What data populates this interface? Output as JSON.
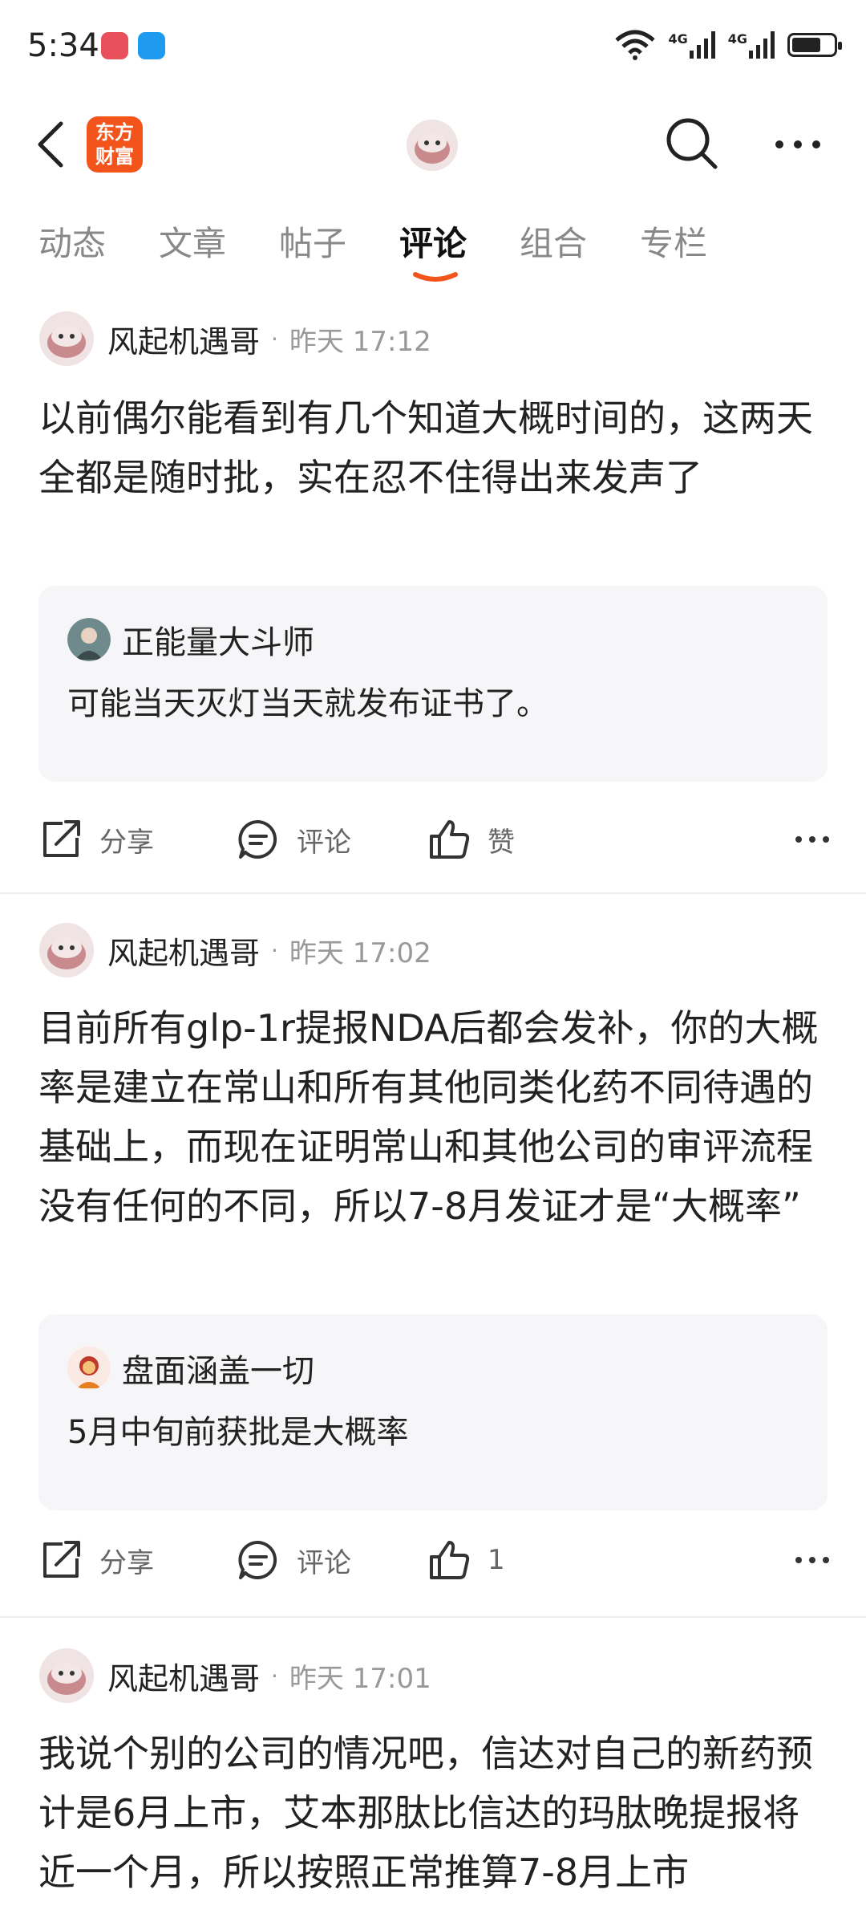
{
  "status_bar": {
    "time": "5:34",
    "network_1": "4G",
    "network_2": "4G",
    "battery_level": 0.7
  },
  "header": {
    "logo_line1": "东方",
    "logo_line2": "财富"
  },
  "tabs": [
    "动态",
    "文章",
    "帖子",
    "评论",
    "组合",
    "专栏"
  ],
  "active_tab": "评论",
  "posts": [
    {
      "author": "风起机遇哥",
      "time": "昨天 17:12",
      "text": "以前偶尔能看到有几个知道大概时间的，这两天全都是随时批，实在忍不住得出来发声了",
      "quote": {
        "user": "正能量大斗师",
        "text": "可能当天灭灯当天就发布证书了。"
      },
      "share_label": "分享",
      "comment_label": "评论",
      "like_label": "赞"
    },
    {
      "author": "风起机遇哥",
      "time": "昨天 17:02",
      "text": "目前所有glp-1r提报NDA后都会发补，你的大概率是建立在常山和所有其他同类化药不同待遇的基础上，而现在证明常山和其他公司的审评流程没有任何的不同，所以7-8月发证才是“大概率”",
      "quote": {
        "user": "盘面涵盖一切",
        "text": "5月中旬前获批是大概率"
      },
      "share_label": "分享",
      "comment_label": "评论",
      "like_label": "1"
    },
    {
      "author": "风起机遇哥",
      "time": "昨天 17:01",
      "text": "我说个别的公司的情况吧，信达对自己的新药预计是6月上市，艾本那肽比信达的玛肽晚提报将近一个月，所以按照正常推算7-8月上市"
    }
  ],
  "colors": {
    "brand": "#f2541b",
    "tab_underline": "#f2541b",
    "text": "#222222",
    "muted": "#999999",
    "quote_bg": "#f6f6f8"
  }
}
